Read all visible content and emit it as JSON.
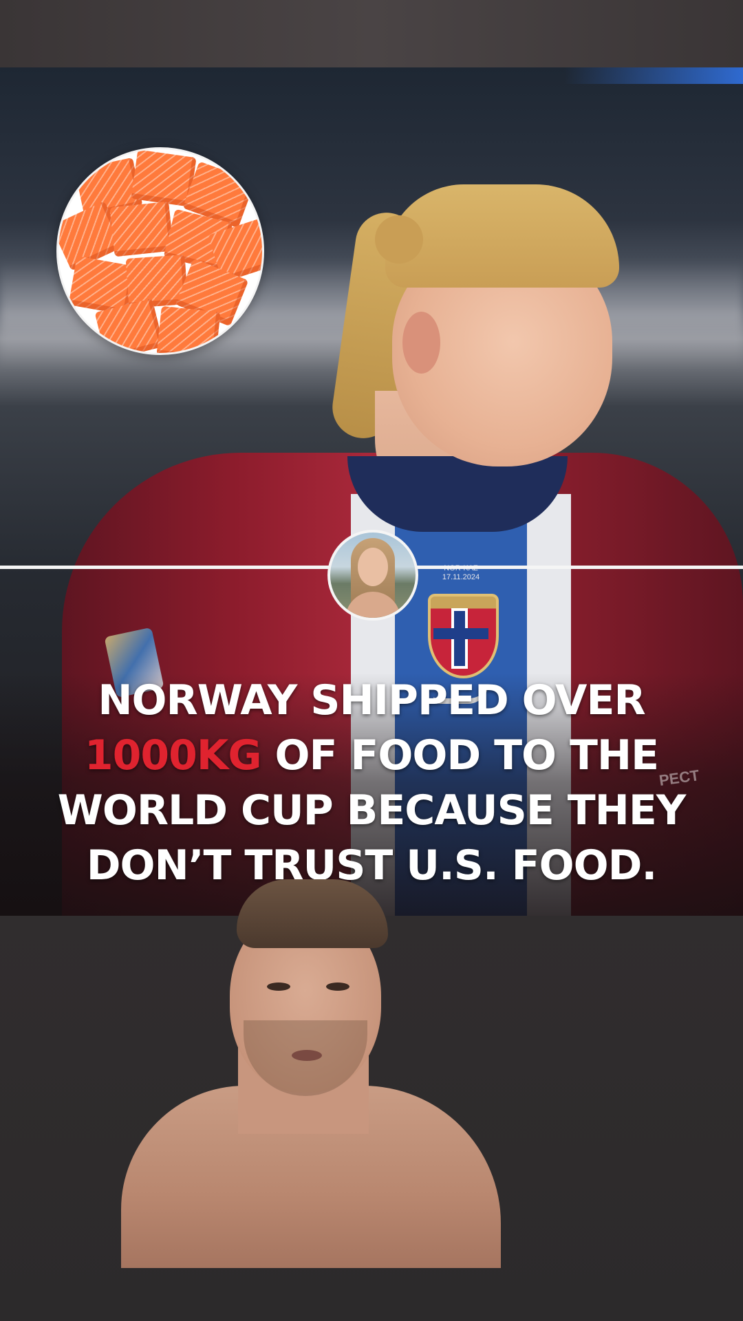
{
  "caption": {
    "line1": "NORWAY SHIPPED OVER",
    "highlight": "1000KG",
    "line2_rest": " OF FOOD TO THE",
    "line3": "WORLD CUP BECAUSE THEY",
    "line4": "DON’T TRUST U.S. FOOD."
  },
  "jersey": {
    "match_label": "NOR-KAZ",
    "match_date": "17.11.2024",
    "sleeve_text": "PECT"
  },
  "colors": {
    "caption_text": "#ffffff",
    "caption_accent": "#e0232f",
    "shirt_red": "#a8283a",
    "shirt_blue": "#2f5fb0",
    "salmon": "#ff7a3c"
  },
  "icons": {
    "food_image": "salmon-cubes",
    "center_avatar": "creator-avatar"
  }
}
